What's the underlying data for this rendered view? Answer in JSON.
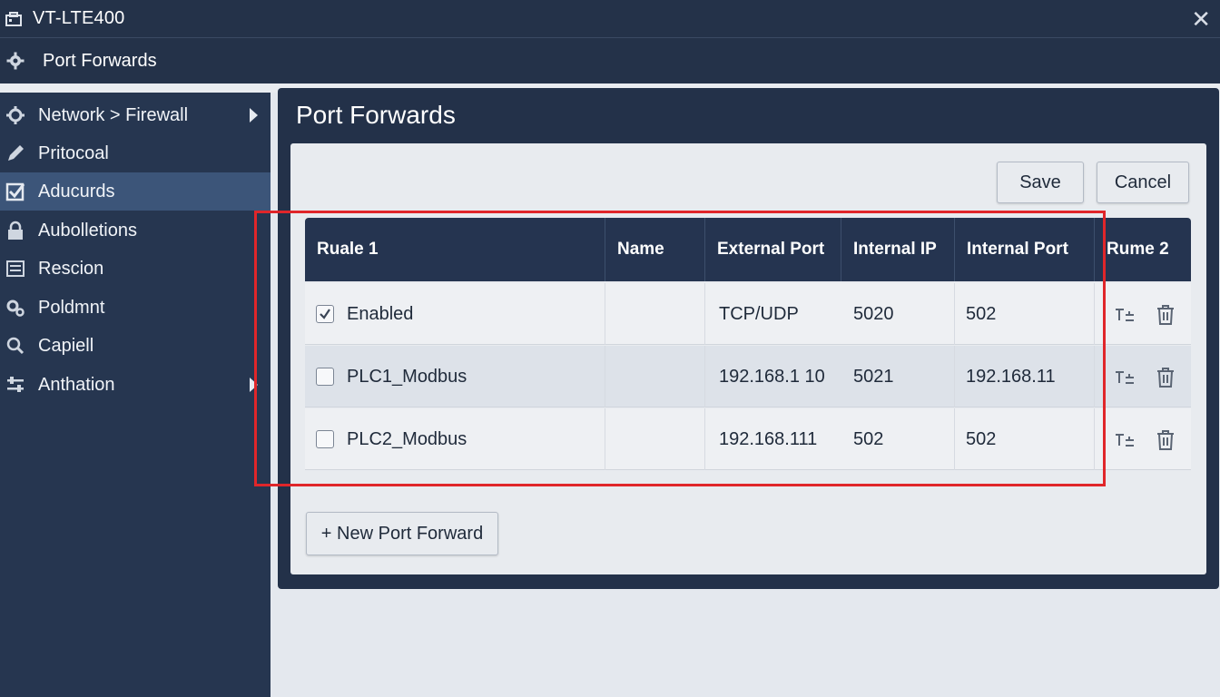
{
  "window": {
    "title": "VT-LTE400",
    "close_glyph": "✕"
  },
  "breadcrumb": {
    "label": "Port Forwards"
  },
  "sidebar": {
    "items": [
      {
        "label": "Network > Firewall",
        "icon": "network-gear-icon",
        "has_submenu": true
      },
      {
        "label": "Pritocoal",
        "icon": "pencil-icon",
        "has_submenu": false
      },
      {
        "label": "Aducurds",
        "icon": "checkbox-icon",
        "has_submenu": false,
        "active": true
      },
      {
        "label": "Aubolletions",
        "icon": "lock-icon",
        "has_submenu": false
      },
      {
        "label": "Rescion",
        "icon": "list-icon",
        "has_submenu": false
      },
      {
        "label": "Poldmnt",
        "icon": "gears-icon",
        "has_submenu": false
      },
      {
        "label": "Capiell",
        "icon": "search-icon",
        "has_submenu": false
      },
      {
        "label": "Anthation",
        "icon": "sliders-icon",
        "has_submenu": true
      }
    ]
  },
  "main": {
    "title": "Port Forwards",
    "save_label": "Save",
    "cancel_label": "Cancel",
    "new_button_label": "+ New Port Forward",
    "table": {
      "headers": [
        "Ruale 1",
        "Name",
        "External Port",
        "Internal IP",
        "Internal Port",
        "Rume 2"
      ],
      "rows": [
        {
          "checked": true,
          "col1": "Enabled",
          "name": "",
          "external_port": "TCP/UDP",
          "internal_ip": "5020",
          "internal_port": "502"
        },
        {
          "checked": false,
          "col1": "PLC1_Modbus",
          "name": "",
          "external_port": "192.168.1 10",
          "internal_ip": "5021",
          "internal_port": "192.168.11"
        },
        {
          "checked": false,
          "col1": "PLC2_Modbus",
          "name": "",
          "external_port": "192.168.111",
          "internal_ip": "502",
          "internal_port": "502"
        }
      ]
    }
  },
  "colors": {
    "header_bg": "#243249",
    "sidebar_bg": "#263650",
    "sidebar_active": "#3c5579",
    "highlight_border": "#e0262a",
    "content_bg": "#e8ebef"
  }
}
